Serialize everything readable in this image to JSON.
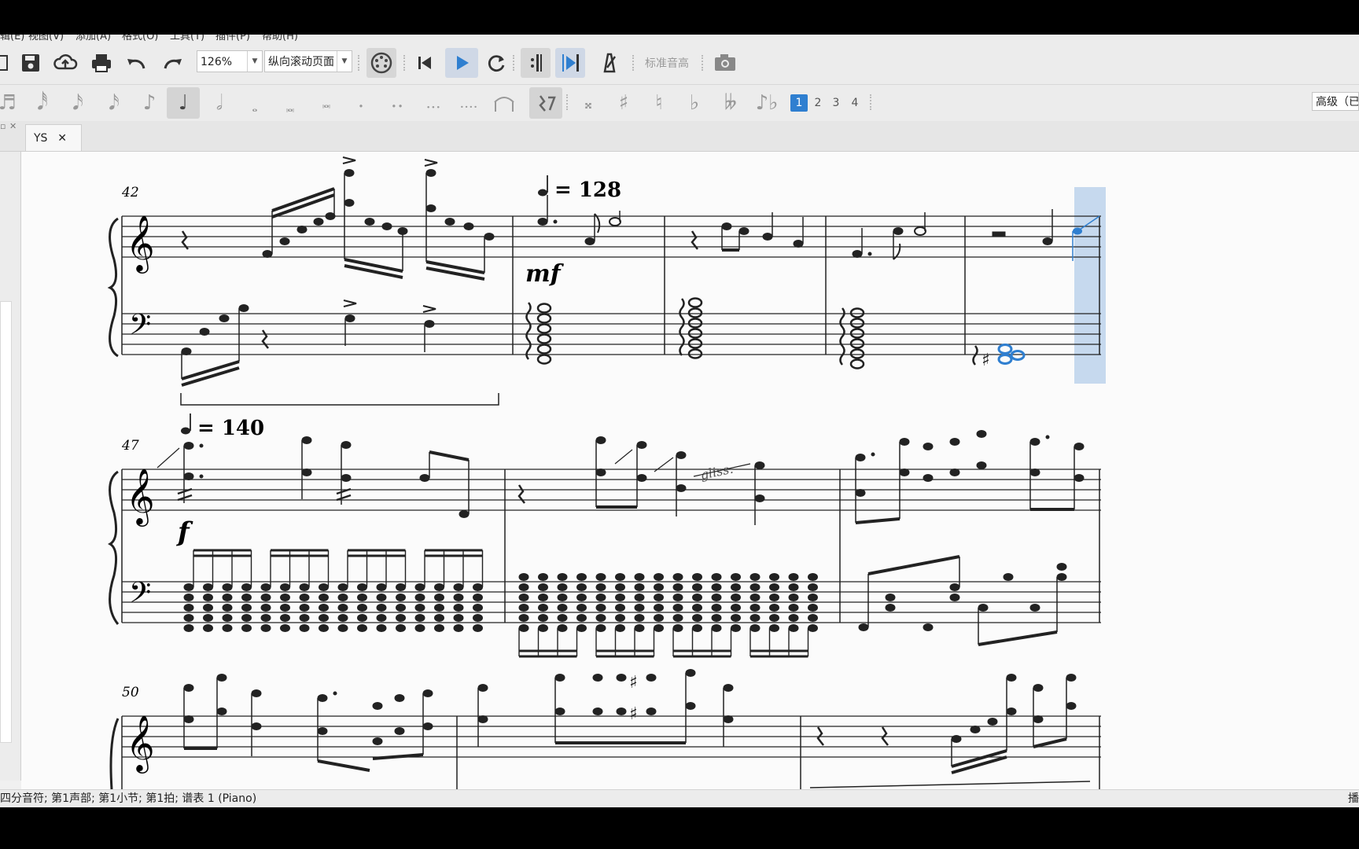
{
  "menu": {
    "edit": "辑(E)",
    "view": "视图(V)",
    "add": "添加(A)",
    "format": "格式(O)",
    "tools": "工具(T)",
    "plugins": "插件(P)",
    "help": "帮助(H)"
  },
  "toolbar": {
    "zoom_value": "126%",
    "view_mode": "纵向滚动页面",
    "concert_pitch": "标准音高",
    "icons": [
      "save-icon",
      "upload-icon",
      "print-icon",
      "undo-icon",
      "redo-icon",
      "midi-input-icon",
      "rewind-icon",
      "play-icon",
      "loop-icon",
      "loop-in-icon",
      "loop-out-icon",
      "metronome-icon",
      "camera-icon"
    ]
  },
  "note_input": {
    "durations": [
      "𝅘𝅥𝅱",
      "𝅘𝅥𝅰",
      "𝅘𝅥𝅯",
      "𝅘𝅥𝅮",
      "♪",
      "♩",
      "𝅗𝅥",
      "𝅝",
      "𝅜",
      "𝅜",
      "·",
      "··",
      "···",
      "····"
    ],
    "accidentals": [
      "𝄪",
      "♯",
      "♮",
      "♭",
      "𝄫"
    ],
    "voices": [
      "1",
      "2",
      "3",
      "4"
    ],
    "active_voice": "1",
    "workspace": "高级（已"
  },
  "tabs": [
    {
      "label": "YS",
      "close": "✕"
    }
  ],
  "score": {
    "systems": [
      {
        "measure": "42",
        "tempo_value": "= 128",
        "dynamic": "mf"
      },
      {
        "measure": "47",
        "tempo_value": "= 140",
        "dynamic": "f",
        "gliss": "gliss."
      },
      {
        "measure": "50"
      }
    ]
  },
  "status": {
    "left": "四分音符; 第1声部;  第1小节; 第1拍; 谱表 1 (Piano)",
    "right": "播"
  },
  "colors": {
    "play_blue": "#2f7fd0",
    "selection": "#c6d9ee",
    "selected_note": "#2f7fd0"
  }
}
